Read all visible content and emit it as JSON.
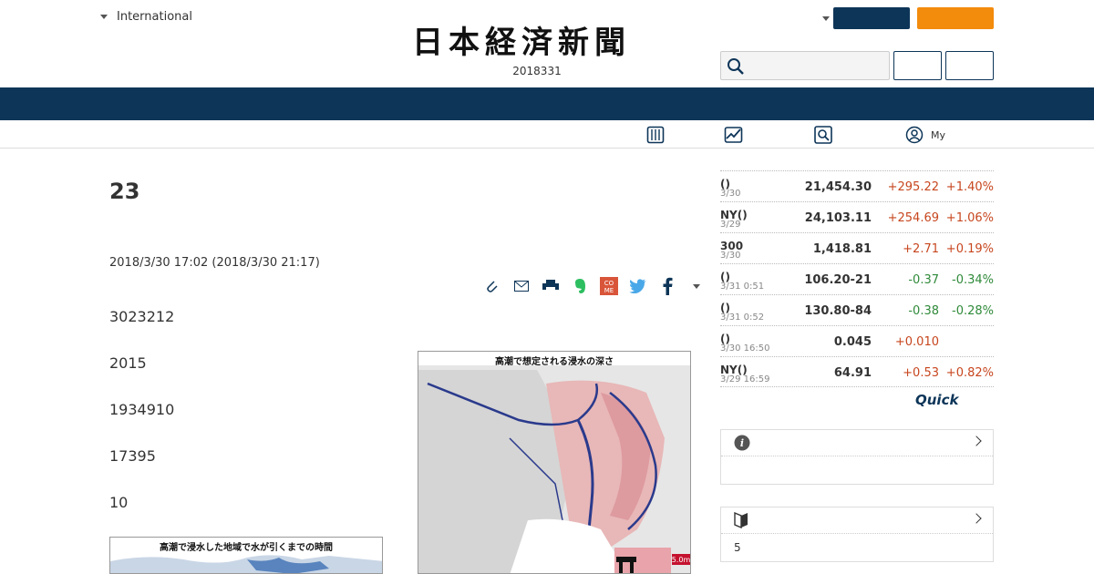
{
  "header": {
    "edition": "International",
    "logo": "日本経済新聞",
    "date": "2018331"
  },
  "subnav": {
    "my_label": "My"
  },
  "article": {
    "title": "23",
    "published": "2018/3/30 17:02 (2018/3/30 21:17)",
    "paragraphs": [
      "3023212",
      "2015",
      "1934910",
      "17395",
      "10"
    ],
    "figure_left_caption": "高潮で浸水した地域で水が引くまでの時間",
    "figure_right_caption": "高潮で想定される浸水の深さ",
    "figure_right_marker": "5.0m"
  },
  "markets": [
    {
      "name": "()",
      "time": "3/30",
      "value": "21,454.30",
      "change": "+295.22",
      "pct": "+1.40%",
      "dir": "up"
    },
    {
      "name": "NY()",
      "time": "3/29",
      "value": "24,103.11",
      "change": "+254.69",
      "pct": "+1.06%",
      "dir": "up"
    },
    {
      "name": "300",
      "time": "3/30",
      "value": "1,418.81",
      "change": "+2.71",
      "pct": "+0.19%",
      "dir": "up"
    },
    {
      "name": "()",
      "time": "3/31 0:51",
      "value": "106.20-21",
      "change": "-0.37",
      "pct": "-0.34%",
      "dir": "dn"
    },
    {
      "name": "()",
      "time": "3/31 0:52",
      "value": "130.80-84",
      "change": "-0.38",
      "pct": "-0.28%",
      "dir": "dn"
    },
    {
      "name": "()",
      "time": "3/30 16:50",
      "value": "0.045",
      "change": "+0.010",
      "pct": "",
      "dir": "up"
    },
    {
      "name": "NY()",
      "time": "3/29 16:59",
      "value": "64.91",
      "change": "+0.53",
      "pct": "+0.82%",
      "dir": "up"
    }
  ],
  "quick_logo": "Quick",
  "box2": {
    "body": "5"
  },
  "colors": {
    "navy": "#0d3558",
    "orange": "#f38b0c",
    "up": "#c7461e",
    "down": "#2f8a3a"
  }
}
